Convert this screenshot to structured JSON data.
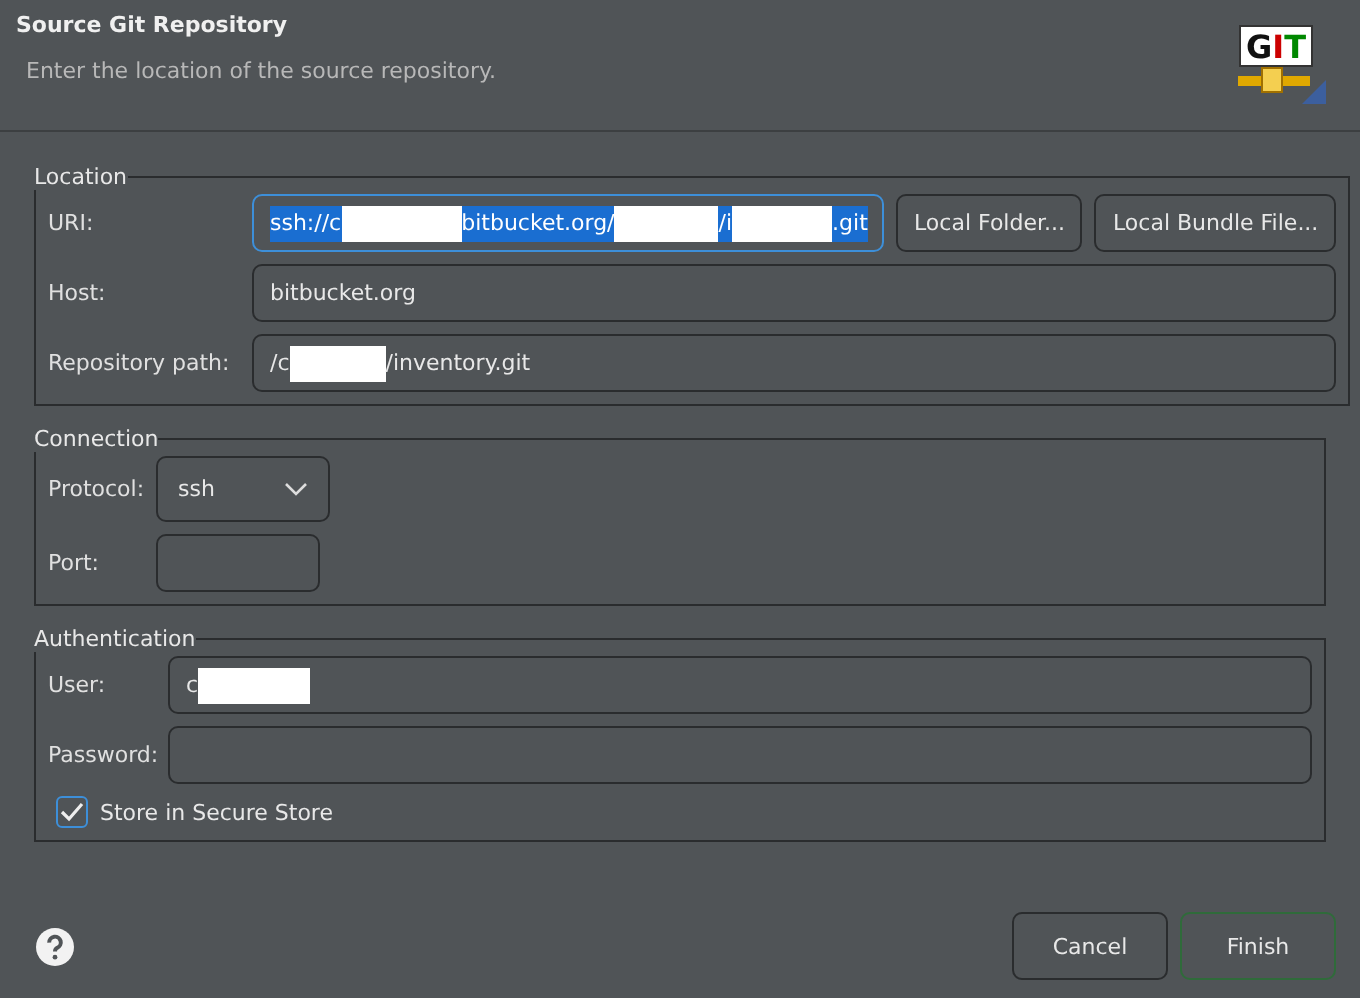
{
  "header": {
    "title": "Source Git Repository",
    "subtitle": "Enter the location of the source repository.",
    "logo": "GIT"
  },
  "location": {
    "label": "Location",
    "uri": {
      "label": "URI:",
      "parts": [
        "ssh://c",
        "bitbucket.org/",
        "/i",
        ".git"
      ],
      "focused": true
    },
    "buttons": [
      "Local Folder...",
      "Local Bundle File..."
    ],
    "host": {
      "label": "Host:",
      "value": "bitbucket.org"
    },
    "path": {
      "label": "Repository path:",
      "parts": [
        "/c",
        "/inventory.git"
      ]
    }
  },
  "connection": {
    "label": "Connection",
    "protocol": {
      "label": "Protocol:",
      "value": "ssh"
    },
    "port": {
      "label": "Port:"
    }
  },
  "authentication": {
    "label": "Authentication",
    "user": {
      "label": "User:",
      "parts": [
        "c"
      ]
    },
    "password": {
      "label": "Password:"
    },
    "store": {
      "label": "Store in Secure Store",
      "checked": true
    }
  },
  "footer": {
    "buttons": [
      {
        "label": "Cancel",
        "default": false
      },
      {
        "label": "Finish",
        "default": true
      }
    ]
  }
}
